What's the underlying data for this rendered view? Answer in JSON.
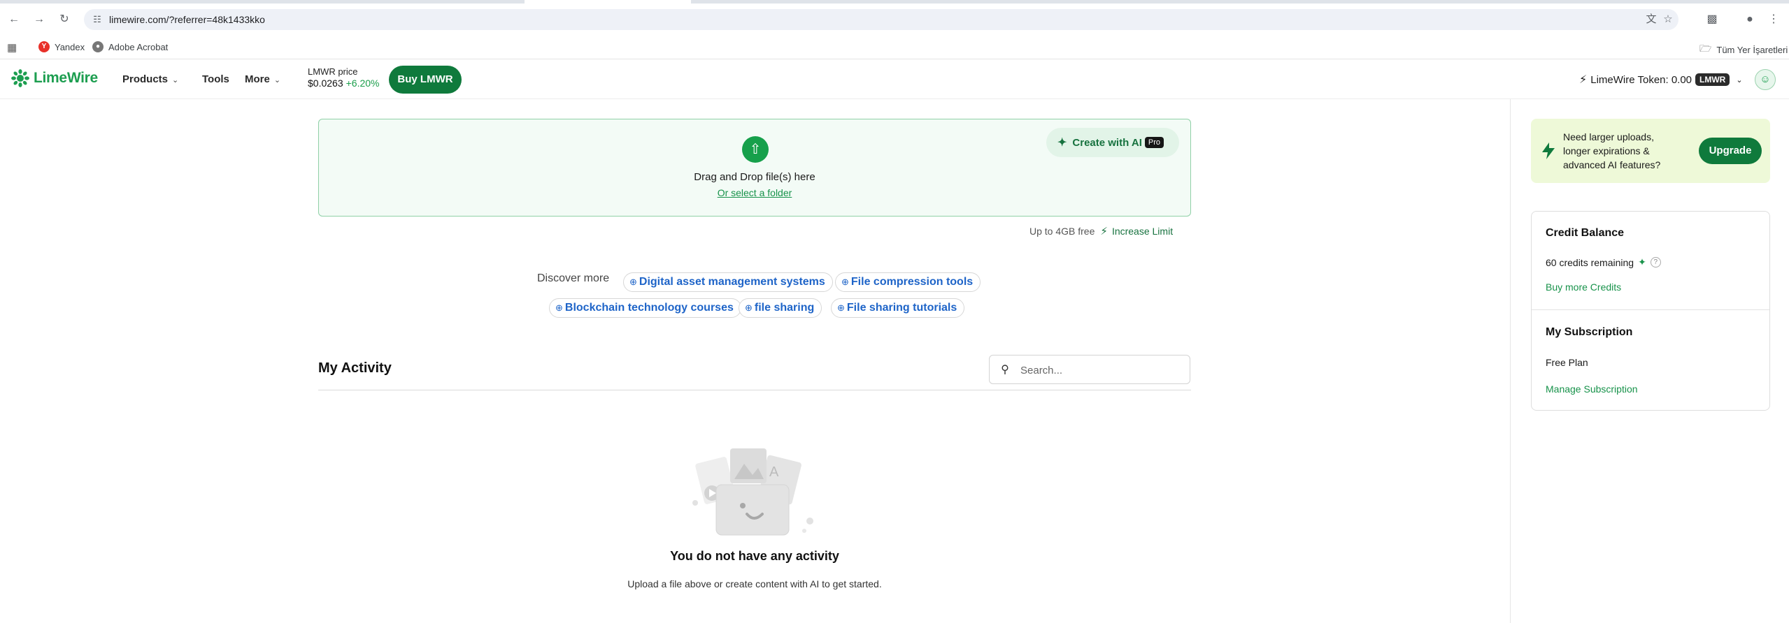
{
  "browser": {
    "url": "limewire.com/?referrer=48k1433kko",
    "bookmarks": [
      {
        "label": "Yandex"
      },
      {
        "label": "Adobe Acrobat"
      }
    ],
    "all_bookmarks_label": "Tüm Yer İşaretleri"
  },
  "header": {
    "brand": "LimeWire",
    "nav": [
      {
        "label": "Products",
        "has_dropdown": true
      },
      {
        "label": "Tools",
        "has_dropdown": false
      },
      {
        "label": "More",
        "has_dropdown": true
      }
    ],
    "price_label": "LMWR price",
    "price_value": "$0.0263",
    "price_change": "+6.20%",
    "buy_button": "Buy LMWR",
    "token_label": "LimeWire Token: 0.00",
    "token_badge": "LMWR"
  },
  "upload": {
    "drag_text": "Drag and Drop file(s) here",
    "select_folder": "Or select a folder",
    "create_ai": "Create with AI",
    "pro_badge": "Pro",
    "limit_text": "Up to 4GB free",
    "increase_limit": "Increase Limit"
  },
  "discover": {
    "label": "Discover more",
    "chips": [
      "Digital asset management systems",
      "File compression tools",
      "Blockchain technology courses",
      "file sharing",
      "File sharing tutorials"
    ]
  },
  "activity": {
    "title": "My Activity",
    "search_placeholder": "Search...",
    "empty_title": "You do not have any activity",
    "empty_subtitle": "Upload a file above or create content with AI to get started."
  },
  "sidebar": {
    "upgrade_text": "Need larger uploads, longer expirations & advanced AI features?",
    "upgrade_button": "Upgrade",
    "credit_title": "Credit Balance",
    "credits_remaining": "60 credits remaining",
    "buy_credits": "Buy more Credits",
    "subscription_title": "My Subscription",
    "plan": "Free Plan",
    "manage_subscription": "Manage Subscription"
  },
  "colors": {
    "brand_green": "#1d9e50",
    "button_green": "#0f7a3c",
    "link_blue": "#1e64c8",
    "upgrade_bg": "#eef9d8"
  }
}
